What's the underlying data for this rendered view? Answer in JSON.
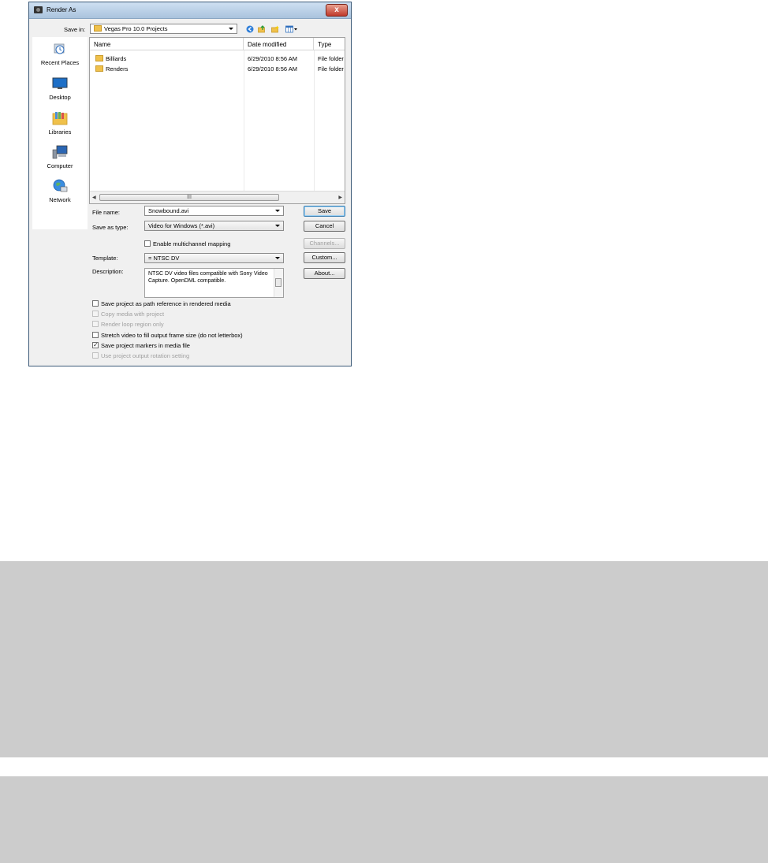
{
  "window": {
    "title": "Render As",
    "close_label": "x"
  },
  "save_in": {
    "label": "Save in:",
    "value": "Vegas Pro 10.0 Projects"
  },
  "places": [
    {
      "label": "Recent Places",
      "icon": "recent-places-icon"
    },
    {
      "label": "Desktop",
      "icon": "desktop-icon"
    },
    {
      "label": "Libraries",
      "icon": "libraries-icon"
    },
    {
      "label": "Computer",
      "icon": "computer-icon"
    },
    {
      "label": "Network",
      "icon": "network-icon"
    }
  ],
  "file_list": {
    "columns": [
      "Name",
      "Date modified",
      "Type"
    ],
    "rows": [
      {
        "name": "Billiards",
        "date": "6/29/2010 8:56 AM",
        "type": "File folder"
      },
      {
        "name": "Renders",
        "date": "6/29/2010 8:56 AM",
        "type": "File folder"
      }
    ],
    "scroll_grip": "III"
  },
  "file_name": {
    "label": "File name:",
    "value": "Snowbound.avi"
  },
  "save_as_type": {
    "label": "Save as type:",
    "value": "Video for Windows (*.avi)"
  },
  "multichannel": {
    "label": "Enable multichannel mapping",
    "checked": false
  },
  "template": {
    "label": "Template:",
    "value": "= NTSC DV"
  },
  "description": {
    "label": "Description:",
    "text": "NTSC DV video files compatible with Sony Video Capture. OpenDML compatible."
  },
  "buttons": {
    "save": "Save",
    "cancel": "Cancel",
    "channels": "Channels...",
    "custom": "Custom...",
    "about": "About..."
  },
  "options": [
    {
      "label": "Save project as path reference in rendered media",
      "checked": false,
      "enabled": true
    },
    {
      "label": "Copy media with project",
      "checked": false,
      "enabled": false
    },
    {
      "label": "Render loop region only",
      "checked": false,
      "enabled": false
    },
    {
      "label": "Stretch video to fill output frame size (do not letterbox)",
      "checked": false,
      "enabled": true
    },
    {
      "label": "Save project markers in media file",
      "checked": true,
      "enabled": true
    },
    {
      "label": "Use project output rotation setting",
      "checked": false,
      "enabled": false
    }
  ],
  "colors": {
    "accent": "#3c7fb1",
    "folder": "#f0c14b",
    "close": "#c0392b",
    "band": "#cccccc"
  }
}
